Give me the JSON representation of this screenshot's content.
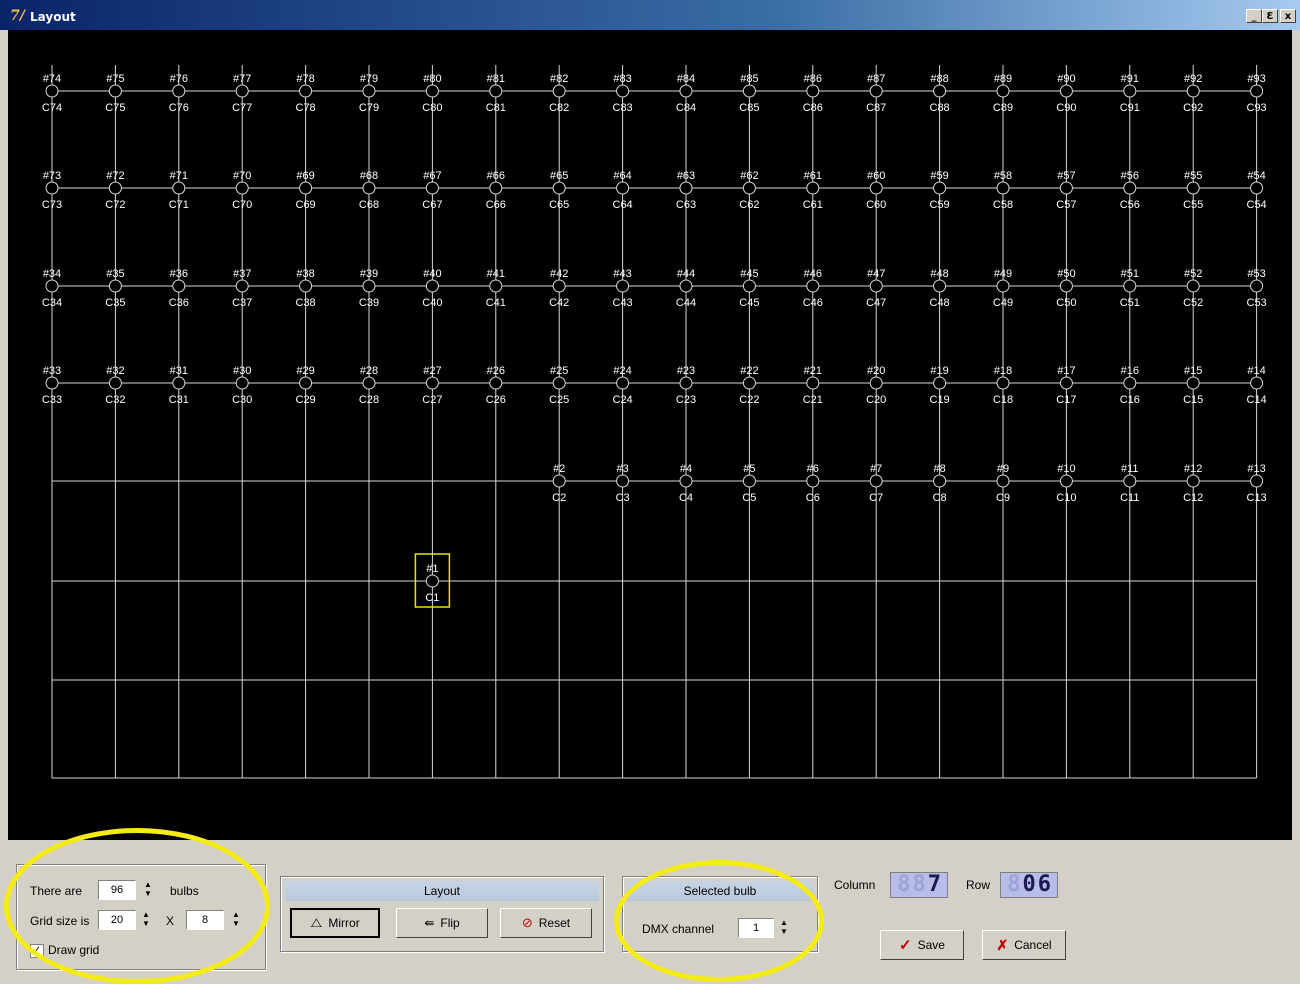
{
  "window": {
    "title": "Layout",
    "app_icon": "7/",
    "controls": {
      "minimize": "_",
      "maximize": "Ɛ",
      "close": "x"
    }
  },
  "grid": {
    "columns": 20,
    "rows": 8,
    "line_color": "#d8d8d8",
    "label_color": "#ffffff",
    "selected_color": "#e6e600",
    "bulbs": [
      {
        "n": 74,
        "c": "C74",
        "col": 0,
        "row": 0
      },
      {
        "n": 75,
        "c": "C75",
        "col": 1,
        "row": 0
      },
      {
        "n": 76,
        "c": "C76",
        "col": 2,
        "row": 0
      },
      {
        "n": 77,
        "c": "C77",
        "col": 3,
        "row": 0
      },
      {
        "n": 78,
        "c": "C78",
        "col": 4,
        "row": 0
      },
      {
        "n": 79,
        "c": "C79",
        "col": 5,
        "row": 0
      },
      {
        "n": 80,
        "c": "C80",
        "col": 6,
        "row": 0
      },
      {
        "n": 81,
        "c": "C81",
        "col": 7,
        "row": 0
      },
      {
        "n": 82,
        "c": "C82",
        "col": 8,
        "row": 0
      },
      {
        "n": 83,
        "c": "C83",
        "col": 9,
        "row": 0
      },
      {
        "n": 84,
        "c": "C84",
        "col": 10,
        "row": 0
      },
      {
        "n": 85,
        "c": "C85",
        "col": 11,
        "row": 0
      },
      {
        "n": 86,
        "c": "C86",
        "col": 12,
        "row": 0
      },
      {
        "n": 87,
        "c": "C87",
        "col": 13,
        "row": 0
      },
      {
        "n": 88,
        "c": "C88",
        "col": 14,
        "row": 0
      },
      {
        "n": 89,
        "c": "C89",
        "col": 15,
        "row": 0
      },
      {
        "n": 90,
        "c": "C90",
        "col": 16,
        "row": 0
      },
      {
        "n": 91,
        "c": "C91",
        "col": 17,
        "row": 0
      },
      {
        "n": 92,
        "c": "C92",
        "col": 18,
        "row": 0
      },
      {
        "n": 93,
        "c": "C93",
        "col": 19,
        "row": 0
      },
      {
        "n": 73,
        "c": "C73",
        "col": 0,
        "row": 1
      },
      {
        "n": 72,
        "c": "C72",
        "col": 1,
        "row": 1
      },
      {
        "n": 71,
        "c": "C71",
        "col": 2,
        "row": 1
      },
      {
        "n": 70,
        "c": "C70",
        "col": 3,
        "row": 1
      },
      {
        "n": 69,
        "c": "C69",
        "col": 4,
        "row": 1
      },
      {
        "n": 68,
        "c": "C68",
        "col": 5,
        "row": 1
      },
      {
        "n": 67,
        "c": "C67",
        "col": 6,
        "row": 1
      },
      {
        "n": 66,
        "c": "C66",
        "col": 7,
        "row": 1
      },
      {
        "n": 65,
        "c": "C65",
        "col": 8,
        "row": 1
      },
      {
        "n": 64,
        "c": "C64",
        "col": 9,
        "row": 1
      },
      {
        "n": 63,
        "c": "C63",
        "col": 10,
        "row": 1
      },
      {
        "n": 62,
        "c": "C62",
        "col": 11,
        "row": 1
      },
      {
        "n": 61,
        "c": "C61",
        "col": 12,
        "row": 1
      },
      {
        "n": 60,
        "c": "C60",
        "col": 13,
        "row": 1
      },
      {
        "n": 59,
        "c": "C59",
        "col": 14,
        "row": 1
      },
      {
        "n": 58,
        "c": "C58",
        "col": 15,
        "row": 1
      },
      {
        "n": 57,
        "c": "C57",
        "col": 16,
        "row": 1
      },
      {
        "n": 56,
        "c": "C56",
        "col": 17,
        "row": 1
      },
      {
        "n": 55,
        "c": "C55",
        "col": 18,
        "row": 1
      },
      {
        "n": 54,
        "c": "C54",
        "col": 19,
        "row": 1
      },
      {
        "n": 34,
        "c": "C34",
        "col": 0,
        "row": 2
      },
      {
        "n": 35,
        "c": "C35",
        "col": 1,
        "row": 2
      },
      {
        "n": 36,
        "c": "C36",
        "col": 2,
        "row": 2
      },
      {
        "n": 37,
        "c": "C37",
        "col": 3,
        "row": 2
      },
      {
        "n": 38,
        "c": "C38",
        "col": 4,
        "row": 2
      },
      {
        "n": 39,
        "c": "C39",
        "col": 5,
        "row": 2
      },
      {
        "n": 40,
        "c": "C40",
        "col": 6,
        "row": 2
      },
      {
        "n": 41,
        "c": "C41",
        "col": 7,
        "row": 2
      },
      {
        "n": 42,
        "c": "C42",
        "col": 8,
        "row": 2
      },
      {
        "n": 43,
        "c": "C43",
        "col": 9,
        "row": 2
      },
      {
        "n": 44,
        "c": "C44",
        "col": 10,
        "row": 2
      },
      {
        "n": 45,
        "c": "C45",
        "col": 11,
        "row": 2
      },
      {
        "n": 46,
        "c": "C46",
        "col": 12,
        "row": 2
      },
      {
        "n": 47,
        "c": "C47",
        "col": 13,
        "row": 2
      },
      {
        "n": 48,
        "c": "C48",
        "col": 14,
        "row": 2
      },
      {
        "n": 49,
        "c": "C49",
        "col": 15,
        "row": 2
      },
      {
        "n": 50,
        "c": "C50",
        "col": 16,
        "row": 2
      },
      {
        "n": 51,
        "c": "C51",
        "col": 17,
        "row": 2
      },
      {
        "n": 52,
        "c": "C52",
        "col": 18,
        "row": 2
      },
      {
        "n": 53,
        "c": "C53",
        "col": 19,
        "row": 2
      },
      {
        "n": 33,
        "c": "C33",
        "col": 0,
        "row": 3
      },
      {
        "n": 32,
        "c": "C32",
        "col": 1,
        "row": 3
      },
      {
        "n": 31,
        "c": "C31",
        "col": 2,
        "row": 3
      },
      {
        "n": 30,
        "c": "C30",
        "col": 3,
        "row": 3
      },
      {
        "n": 29,
        "c": "C29",
        "col": 4,
        "row": 3
      },
      {
        "n": 28,
        "c": "C28",
        "col": 5,
        "row": 3
      },
      {
        "n": 27,
        "c": "C27",
        "col": 6,
        "row": 3
      },
      {
        "n": 26,
        "c": "C26",
        "col": 7,
        "row": 3
      },
      {
        "n": 25,
        "c": "C25",
        "col": 8,
        "row": 3
      },
      {
        "n": 24,
        "c": "C24",
        "col": 9,
        "row": 3
      },
      {
        "n": 23,
        "c": "C23",
        "col": 10,
        "row": 3
      },
      {
        "n": 22,
        "c": "C22",
        "col": 11,
        "row": 3
      },
      {
        "n": 21,
        "c": "C21",
        "col": 12,
        "row": 3
      },
      {
        "n": 20,
        "c": "C20",
        "col": 13,
        "row": 3
      },
      {
        "n": 19,
        "c": "C19",
        "col": 14,
        "row": 3
      },
      {
        "n": 18,
        "c": "C18",
        "col": 15,
        "row": 3
      },
      {
        "n": 17,
        "c": "C17",
        "col": 16,
        "row": 3
      },
      {
        "n": 16,
        "c": "C16",
        "col": 17,
        "row": 3
      },
      {
        "n": 15,
        "c": "C15",
        "col": 18,
        "row": 3
      },
      {
        "n": 14,
        "c": "C14",
        "col": 19,
        "row": 3
      },
      {
        "n": 2,
        "c": "C2",
        "col": 8,
        "row": 4
      },
      {
        "n": 3,
        "c": "C3",
        "col": 9,
        "row": 4
      },
      {
        "n": 4,
        "c": "C4",
        "col": 10,
        "row": 4
      },
      {
        "n": 5,
        "c": "C5",
        "col": 11,
        "row": 4
      },
      {
        "n": 6,
        "c": "C6",
        "col": 12,
        "row": 4
      },
      {
        "n": 7,
        "c": "C7",
        "col": 13,
        "row": 4
      },
      {
        "n": 8,
        "c": "C8",
        "col": 14,
        "row": 4
      },
      {
        "n": 9,
        "c": "C9",
        "col": 15,
        "row": 4
      },
      {
        "n": 10,
        "c": "C10",
        "col": 16,
        "row": 4
      },
      {
        "n": 11,
        "c": "C11",
        "col": 17,
        "row": 4
      },
      {
        "n": 12,
        "c": "C12",
        "col": 18,
        "row": 4
      },
      {
        "n": 13,
        "c": "C13",
        "col": 19,
        "row": 4
      },
      {
        "n": 1,
        "c": "C1",
        "col": 6,
        "row": 5,
        "selected": true
      }
    ]
  },
  "bulbs_group": {
    "there_are_label": "There are",
    "bulb_count": "96",
    "bulbs_label": "bulbs",
    "grid_size_label": "Grid size is",
    "grid_cols": "20",
    "times_label": "X",
    "grid_rows": "8",
    "draw_grid_label": "Draw grid",
    "draw_grid_checked": true
  },
  "layout_group": {
    "header": "Layout",
    "mirror_label": "Mirror",
    "flip_label": "Flip",
    "reset_label": "Reset"
  },
  "selected_group": {
    "header": "Selected bulb",
    "dmx_label": "DMX channel",
    "dmx_value": "1"
  },
  "position": {
    "column_label": "Column",
    "column_value": "7",
    "row_label": "Row",
    "row_value": "06"
  },
  "actions": {
    "save_label": "Save",
    "cancel_label": "Cancel"
  },
  "highlight_color": "#f4ec14"
}
